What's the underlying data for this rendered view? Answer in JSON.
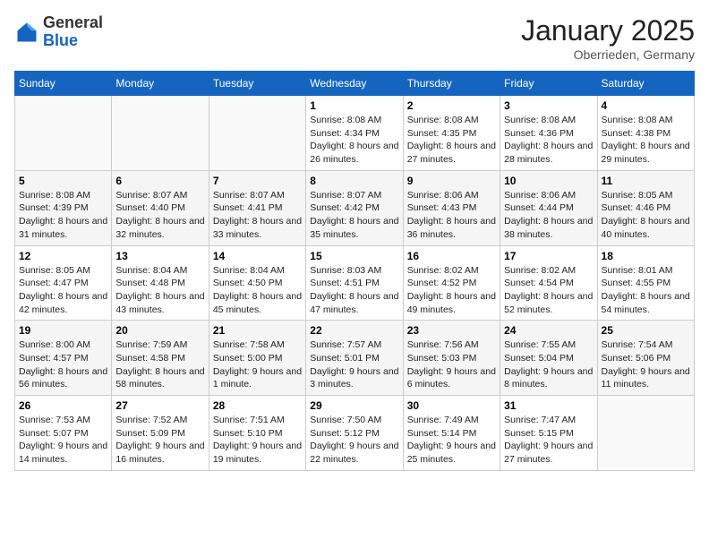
{
  "header": {
    "logo_general": "General",
    "logo_blue": "Blue",
    "month_title": "January 2025",
    "location": "Oberrieden, Germany"
  },
  "days_of_week": [
    "Sunday",
    "Monday",
    "Tuesday",
    "Wednesday",
    "Thursday",
    "Friday",
    "Saturday"
  ],
  "weeks": [
    [
      {
        "day": "",
        "info": ""
      },
      {
        "day": "",
        "info": ""
      },
      {
        "day": "",
        "info": ""
      },
      {
        "day": "1",
        "info": "Sunrise: 8:08 AM\nSunset: 4:34 PM\nDaylight: 8 hours and 26 minutes."
      },
      {
        "day": "2",
        "info": "Sunrise: 8:08 AM\nSunset: 4:35 PM\nDaylight: 8 hours and 27 minutes."
      },
      {
        "day": "3",
        "info": "Sunrise: 8:08 AM\nSunset: 4:36 PM\nDaylight: 8 hours and 28 minutes."
      },
      {
        "day": "4",
        "info": "Sunrise: 8:08 AM\nSunset: 4:38 PM\nDaylight: 8 hours and 29 minutes."
      }
    ],
    [
      {
        "day": "5",
        "info": "Sunrise: 8:08 AM\nSunset: 4:39 PM\nDaylight: 8 hours and 31 minutes."
      },
      {
        "day": "6",
        "info": "Sunrise: 8:07 AM\nSunset: 4:40 PM\nDaylight: 8 hours and 32 minutes."
      },
      {
        "day": "7",
        "info": "Sunrise: 8:07 AM\nSunset: 4:41 PM\nDaylight: 8 hours and 33 minutes."
      },
      {
        "day": "8",
        "info": "Sunrise: 8:07 AM\nSunset: 4:42 PM\nDaylight: 8 hours and 35 minutes."
      },
      {
        "day": "9",
        "info": "Sunrise: 8:06 AM\nSunset: 4:43 PM\nDaylight: 8 hours and 36 minutes."
      },
      {
        "day": "10",
        "info": "Sunrise: 8:06 AM\nSunset: 4:44 PM\nDaylight: 8 hours and 38 minutes."
      },
      {
        "day": "11",
        "info": "Sunrise: 8:05 AM\nSunset: 4:46 PM\nDaylight: 8 hours and 40 minutes."
      }
    ],
    [
      {
        "day": "12",
        "info": "Sunrise: 8:05 AM\nSunset: 4:47 PM\nDaylight: 8 hours and 42 minutes."
      },
      {
        "day": "13",
        "info": "Sunrise: 8:04 AM\nSunset: 4:48 PM\nDaylight: 8 hours and 43 minutes."
      },
      {
        "day": "14",
        "info": "Sunrise: 8:04 AM\nSunset: 4:50 PM\nDaylight: 8 hours and 45 minutes."
      },
      {
        "day": "15",
        "info": "Sunrise: 8:03 AM\nSunset: 4:51 PM\nDaylight: 8 hours and 47 minutes."
      },
      {
        "day": "16",
        "info": "Sunrise: 8:02 AM\nSunset: 4:52 PM\nDaylight: 8 hours and 49 minutes."
      },
      {
        "day": "17",
        "info": "Sunrise: 8:02 AM\nSunset: 4:54 PM\nDaylight: 8 hours and 52 minutes."
      },
      {
        "day": "18",
        "info": "Sunrise: 8:01 AM\nSunset: 4:55 PM\nDaylight: 8 hours and 54 minutes."
      }
    ],
    [
      {
        "day": "19",
        "info": "Sunrise: 8:00 AM\nSunset: 4:57 PM\nDaylight: 8 hours and 56 minutes."
      },
      {
        "day": "20",
        "info": "Sunrise: 7:59 AM\nSunset: 4:58 PM\nDaylight: 8 hours and 58 minutes."
      },
      {
        "day": "21",
        "info": "Sunrise: 7:58 AM\nSunset: 5:00 PM\nDaylight: 9 hours and 1 minute."
      },
      {
        "day": "22",
        "info": "Sunrise: 7:57 AM\nSunset: 5:01 PM\nDaylight: 9 hours and 3 minutes."
      },
      {
        "day": "23",
        "info": "Sunrise: 7:56 AM\nSunset: 5:03 PM\nDaylight: 9 hours and 6 minutes."
      },
      {
        "day": "24",
        "info": "Sunrise: 7:55 AM\nSunset: 5:04 PM\nDaylight: 9 hours and 8 minutes."
      },
      {
        "day": "25",
        "info": "Sunrise: 7:54 AM\nSunset: 5:06 PM\nDaylight: 9 hours and 11 minutes."
      }
    ],
    [
      {
        "day": "26",
        "info": "Sunrise: 7:53 AM\nSunset: 5:07 PM\nDaylight: 9 hours and 14 minutes."
      },
      {
        "day": "27",
        "info": "Sunrise: 7:52 AM\nSunset: 5:09 PM\nDaylight: 9 hours and 16 minutes."
      },
      {
        "day": "28",
        "info": "Sunrise: 7:51 AM\nSunset: 5:10 PM\nDaylight: 9 hours and 19 minutes."
      },
      {
        "day": "29",
        "info": "Sunrise: 7:50 AM\nSunset: 5:12 PM\nDaylight: 9 hours and 22 minutes."
      },
      {
        "day": "30",
        "info": "Sunrise: 7:49 AM\nSunset: 5:14 PM\nDaylight: 9 hours and 25 minutes."
      },
      {
        "day": "31",
        "info": "Sunrise: 7:47 AM\nSunset: 5:15 PM\nDaylight: 9 hours and 27 minutes."
      },
      {
        "day": "",
        "info": ""
      }
    ]
  ]
}
